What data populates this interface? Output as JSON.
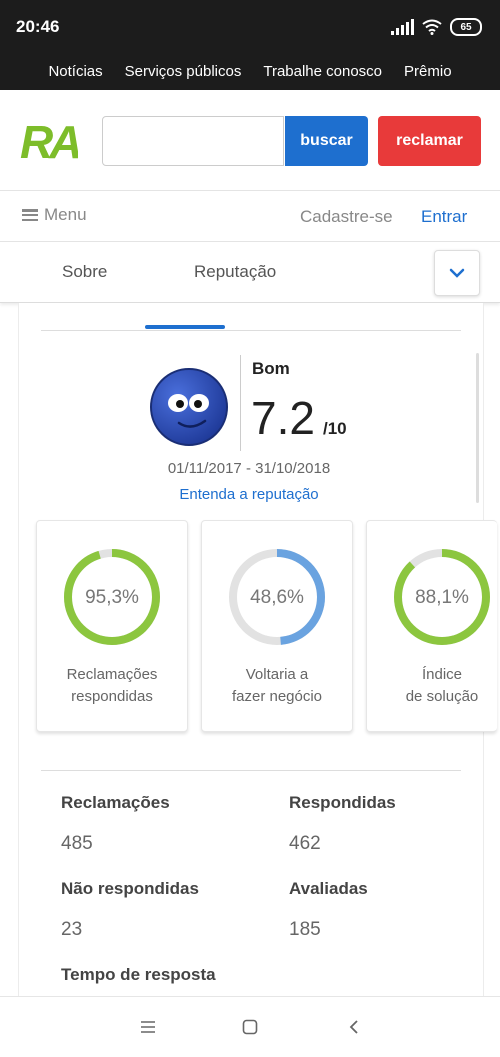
{
  "status_bar": {
    "time": "20:46",
    "battery": "65",
    "icons": [
      "signal-icon",
      "wifi-icon",
      "battery-icon"
    ]
  },
  "top_nav": {
    "items": [
      "Notícias",
      "Serviços públicos",
      "Trabalhe conosco",
      "Prêmio"
    ]
  },
  "header": {
    "logo_text": "RA",
    "search_placeholder": "",
    "search_button": "buscar",
    "complain_button": "reclamar",
    "colors": {
      "search": "#1e6fcf",
      "complain": "#e83a3a",
      "logo_green": "#7dbd2a"
    }
  },
  "menu_row": {
    "menu": "Menu",
    "signup": "Cadastre-se",
    "login": "Entrar"
  },
  "tabs": {
    "about": "Sobre",
    "reputation": "Reputação",
    "toggle_icon": "chevron-down-icon"
  },
  "reputation": {
    "label": "Bom",
    "score": "7.2",
    "max": "/10",
    "period": "01/11/2017 - 31/10/2018",
    "understand_link": "Entenda a reputação"
  },
  "metrics": [
    {
      "value_text": "95,3%",
      "value": 95.3,
      "label_line1": "Reclamações",
      "label_line2": "respondidas",
      "color": "#8cc63f"
    },
    {
      "value_text": "48,6%",
      "value": 48.6,
      "label_line1": "Voltaria a",
      "label_line2": "fazer negócio",
      "color": "#6aa3e0"
    },
    {
      "value_text": "88,1%",
      "value": 88.1,
      "label_line1": "Índice",
      "label_line2": "de solução",
      "color": "#8cc63f"
    }
  ],
  "stats": {
    "complaints_label": "Reclamações",
    "complaints_value": "485",
    "answered_label": "Respondidas",
    "answered_value": "462",
    "unanswered_label": "Não respondidas",
    "unanswered_value": "23",
    "rated_label": "Avaliadas",
    "rated_value": "185",
    "response_time_label": "Tempo de resposta"
  },
  "bottom_nav": {
    "icons": [
      "menu-lines-icon",
      "home-square-icon",
      "back-chevron-icon"
    ]
  }
}
